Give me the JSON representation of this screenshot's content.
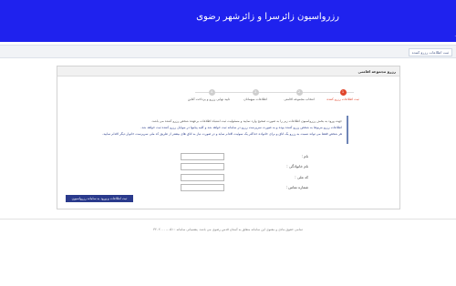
{
  "header": {
    "title": "رزرواسیون زائرسرا و زائرشهر رضوی",
    "edge_mark": "."
  },
  "breadcrumb": {
    "label": "ثبت اطلاعات رزرو کننده"
  },
  "panel": {
    "title": "رزرو مجموعه اقامتی"
  },
  "steps": [
    {
      "number": "1",
      "label": "ثبت اطلاعات رزرو کننده",
      "active": true
    },
    {
      "number": "2",
      "label": "انتخاب مجموعه اقامتی",
      "active": false
    },
    {
      "number": "3",
      "label": "اطلاعات میهمانان",
      "active": false
    },
    {
      "number": "4",
      "label": "تایید نهایی رزرو و پرداخت آنلاین",
      "active": false
    }
  ],
  "notes": [
    "جهت ورود به بخش رزرواسیون اطلاعات زیر را به صورت صحیح وارد نمایید و مسئولیت ثبت اشتباه اطلاعات برعهده شخص رزرو کننده می باشد.",
    "اطلاعات رزرو مربوط به شخص رزرو کننده بوده و به صورت سرپرست رزرو در سامانه ثبت خواهد شد و کلیه پیامها در موبایل رزرو کننده ثبت خواهد شد.",
    "هر شخص فقط می تواند نسبت به رزرو یک اتاق و برای خانواده حداکثر یک سوئیت اقدام نماید و در صورت نیاز به اتاق های بیشتر از طریق کد ملی سرپرست خانوار دیگر اقدام نمایید."
  ],
  "form": {
    "fields": [
      {
        "label": "نام :",
        "value": "",
        "placeholder": ""
      },
      {
        "label": "نام خانوادگی :",
        "value": "",
        "placeholder": ""
      },
      {
        "label": "کد ملی :",
        "value": "",
        "placeholder": ""
      },
      {
        "label": "شماره تماس :",
        "value": "",
        "placeholder": ""
      }
    ],
    "submit_label": "ثبت اطلاعات و ورود به سامانه رزرواسیون"
  },
  "footer": {
    "text": "تمامی حقوق مادی و معنوی این سامانه متعلق به آستان قدس رضوی می باشد. پشتیبانی سامانه : ۰۵۱-۳۲۰۲۰۰۰۰"
  }
}
